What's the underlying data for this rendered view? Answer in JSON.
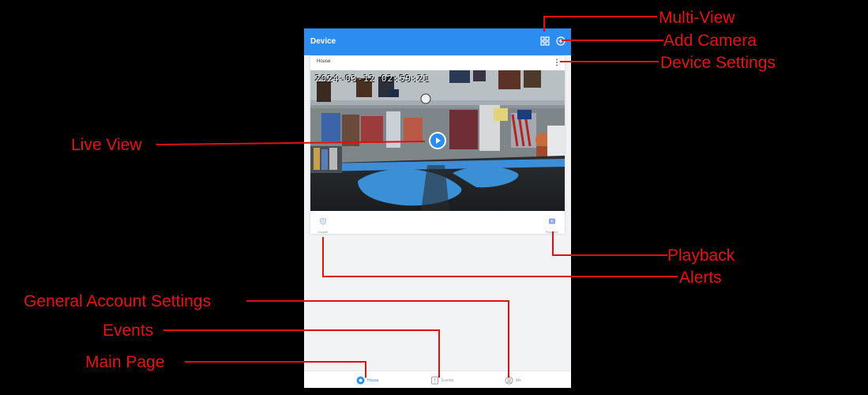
{
  "app": {
    "title": "Device",
    "multi_view_icon": "grid-icon",
    "add_camera_icon": "plus-circle-icon"
  },
  "camera_card": {
    "name": "House",
    "settings_icon": "kebab-icon",
    "timestamp": "2024-03-12  02:59:21",
    "play_icon": "play-icon",
    "footer": {
      "alerts_label": "Disable",
      "playback_label": "Playback"
    }
  },
  "tabbar": {
    "tabs": [
      {
        "label": "House",
        "icon": "home-icon",
        "active": true
      },
      {
        "label": "Events",
        "icon": "events-icon",
        "active": false
      },
      {
        "label": "Me",
        "icon": "account-icon",
        "active": false
      }
    ]
  },
  "colors": {
    "brand_blue": "#2d8cf0",
    "callout_red": "#e81414",
    "inactive_gray": "#999999"
  },
  "callouts": {
    "multi_view": "Multi-View",
    "add_camera": "Add Camera",
    "device_settings": "Device Settings",
    "live_view": "Live View",
    "playback": "Playback",
    "alerts": "Alerts",
    "account_settings": "General Account Settings",
    "events": "Events",
    "main_page": "Main Page"
  }
}
